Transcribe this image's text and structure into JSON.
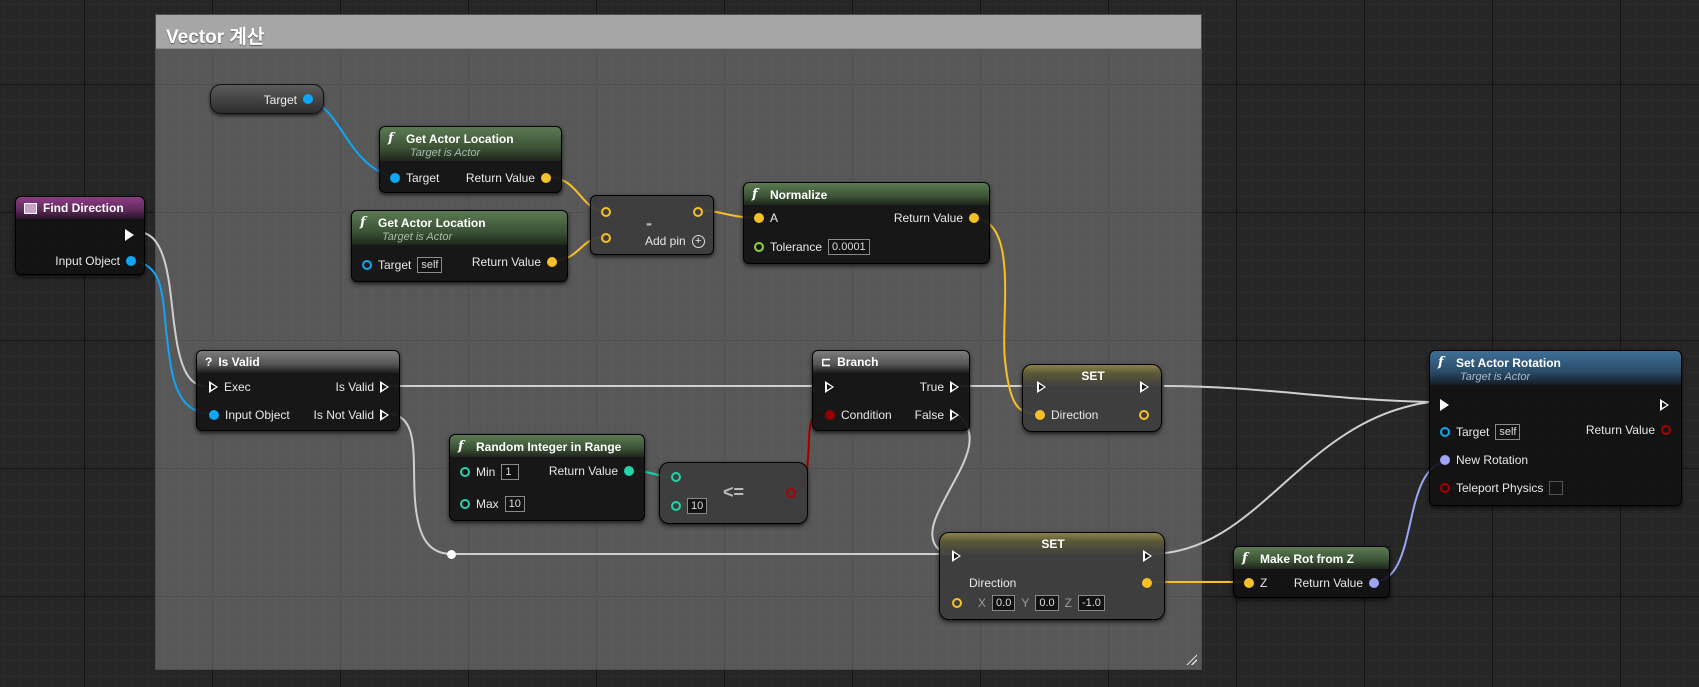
{
  "comment": {
    "title": "Vector 계산"
  },
  "target_var": {
    "label": "Target"
  },
  "find_direction": {
    "title": "Find Direction",
    "input_object": "Input Object"
  },
  "get_actor_location_1": {
    "title": "Get Actor Location",
    "subtitle": "Target is Actor",
    "target": "Target",
    "return_value": "Return Value"
  },
  "get_actor_location_2": {
    "title": "Get Actor Location",
    "subtitle": "Target is Actor",
    "target": "Target",
    "target_value": "self",
    "return_value": "Return Value"
  },
  "subtract_node": {
    "operator": "-",
    "add_pin": "Add pin"
  },
  "normalize": {
    "title": "Normalize",
    "a": "A",
    "tolerance": "Tolerance",
    "tolerance_value": "0.0001",
    "return_value": "Return Value"
  },
  "is_valid": {
    "title": "Is Valid",
    "exec": "Exec",
    "input_object": "Input Object",
    "is_valid": "Is Valid",
    "is_not_valid": "Is Not Valid"
  },
  "branch": {
    "title": "Branch",
    "condition": "Condition",
    "true_label": "True",
    "false_label": "False"
  },
  "set_top": {
    "title": "SET",
    "direction": "Direction"
  },
  "random_int": {
    "title": "Random Integer in Range",
    "min": "Min",
    "min_value": "1",
    "max": "Max",
    "max_value": "10",
    "return_value": "Return Value"
  },
  "compare_node": {
    "operator": "<=",
    "value": "10"
  },
  "set_bottom": {
    "title": "SET",
    "direction": "Direction",
    "x_label": "X",
    "x_value": "0.0",
    "y_label": "Y",
    "y_value": "0.0",
    "z_label": "Z",
    "z_value": "-1.0"
  },
  "make_rot": {
    "title": "Make Rot from Z",
    "z": "Z",
    "return_value": "Return Value"
  },
  "set_actor_rotation": {
    "title": "Set Actor Rotation",
    "subtitle": "Target is Actor",
    "target": "Target",
    "target_value": "self",
    "return_value": "Return Value",
    "new_rotation": "New Rotation",
    "teleport_physics": "Teleport Physics"
  },
  "colors": {
    "exec": "#ffffff",
    "object": "#0ea6f5",
    "vector": "#f6c029",
    "integer": "#21d3a8",
    "bool": "#960000",
    "rotator": "#9ea4f6",
    "float": "#8bd53a"
  }
}
